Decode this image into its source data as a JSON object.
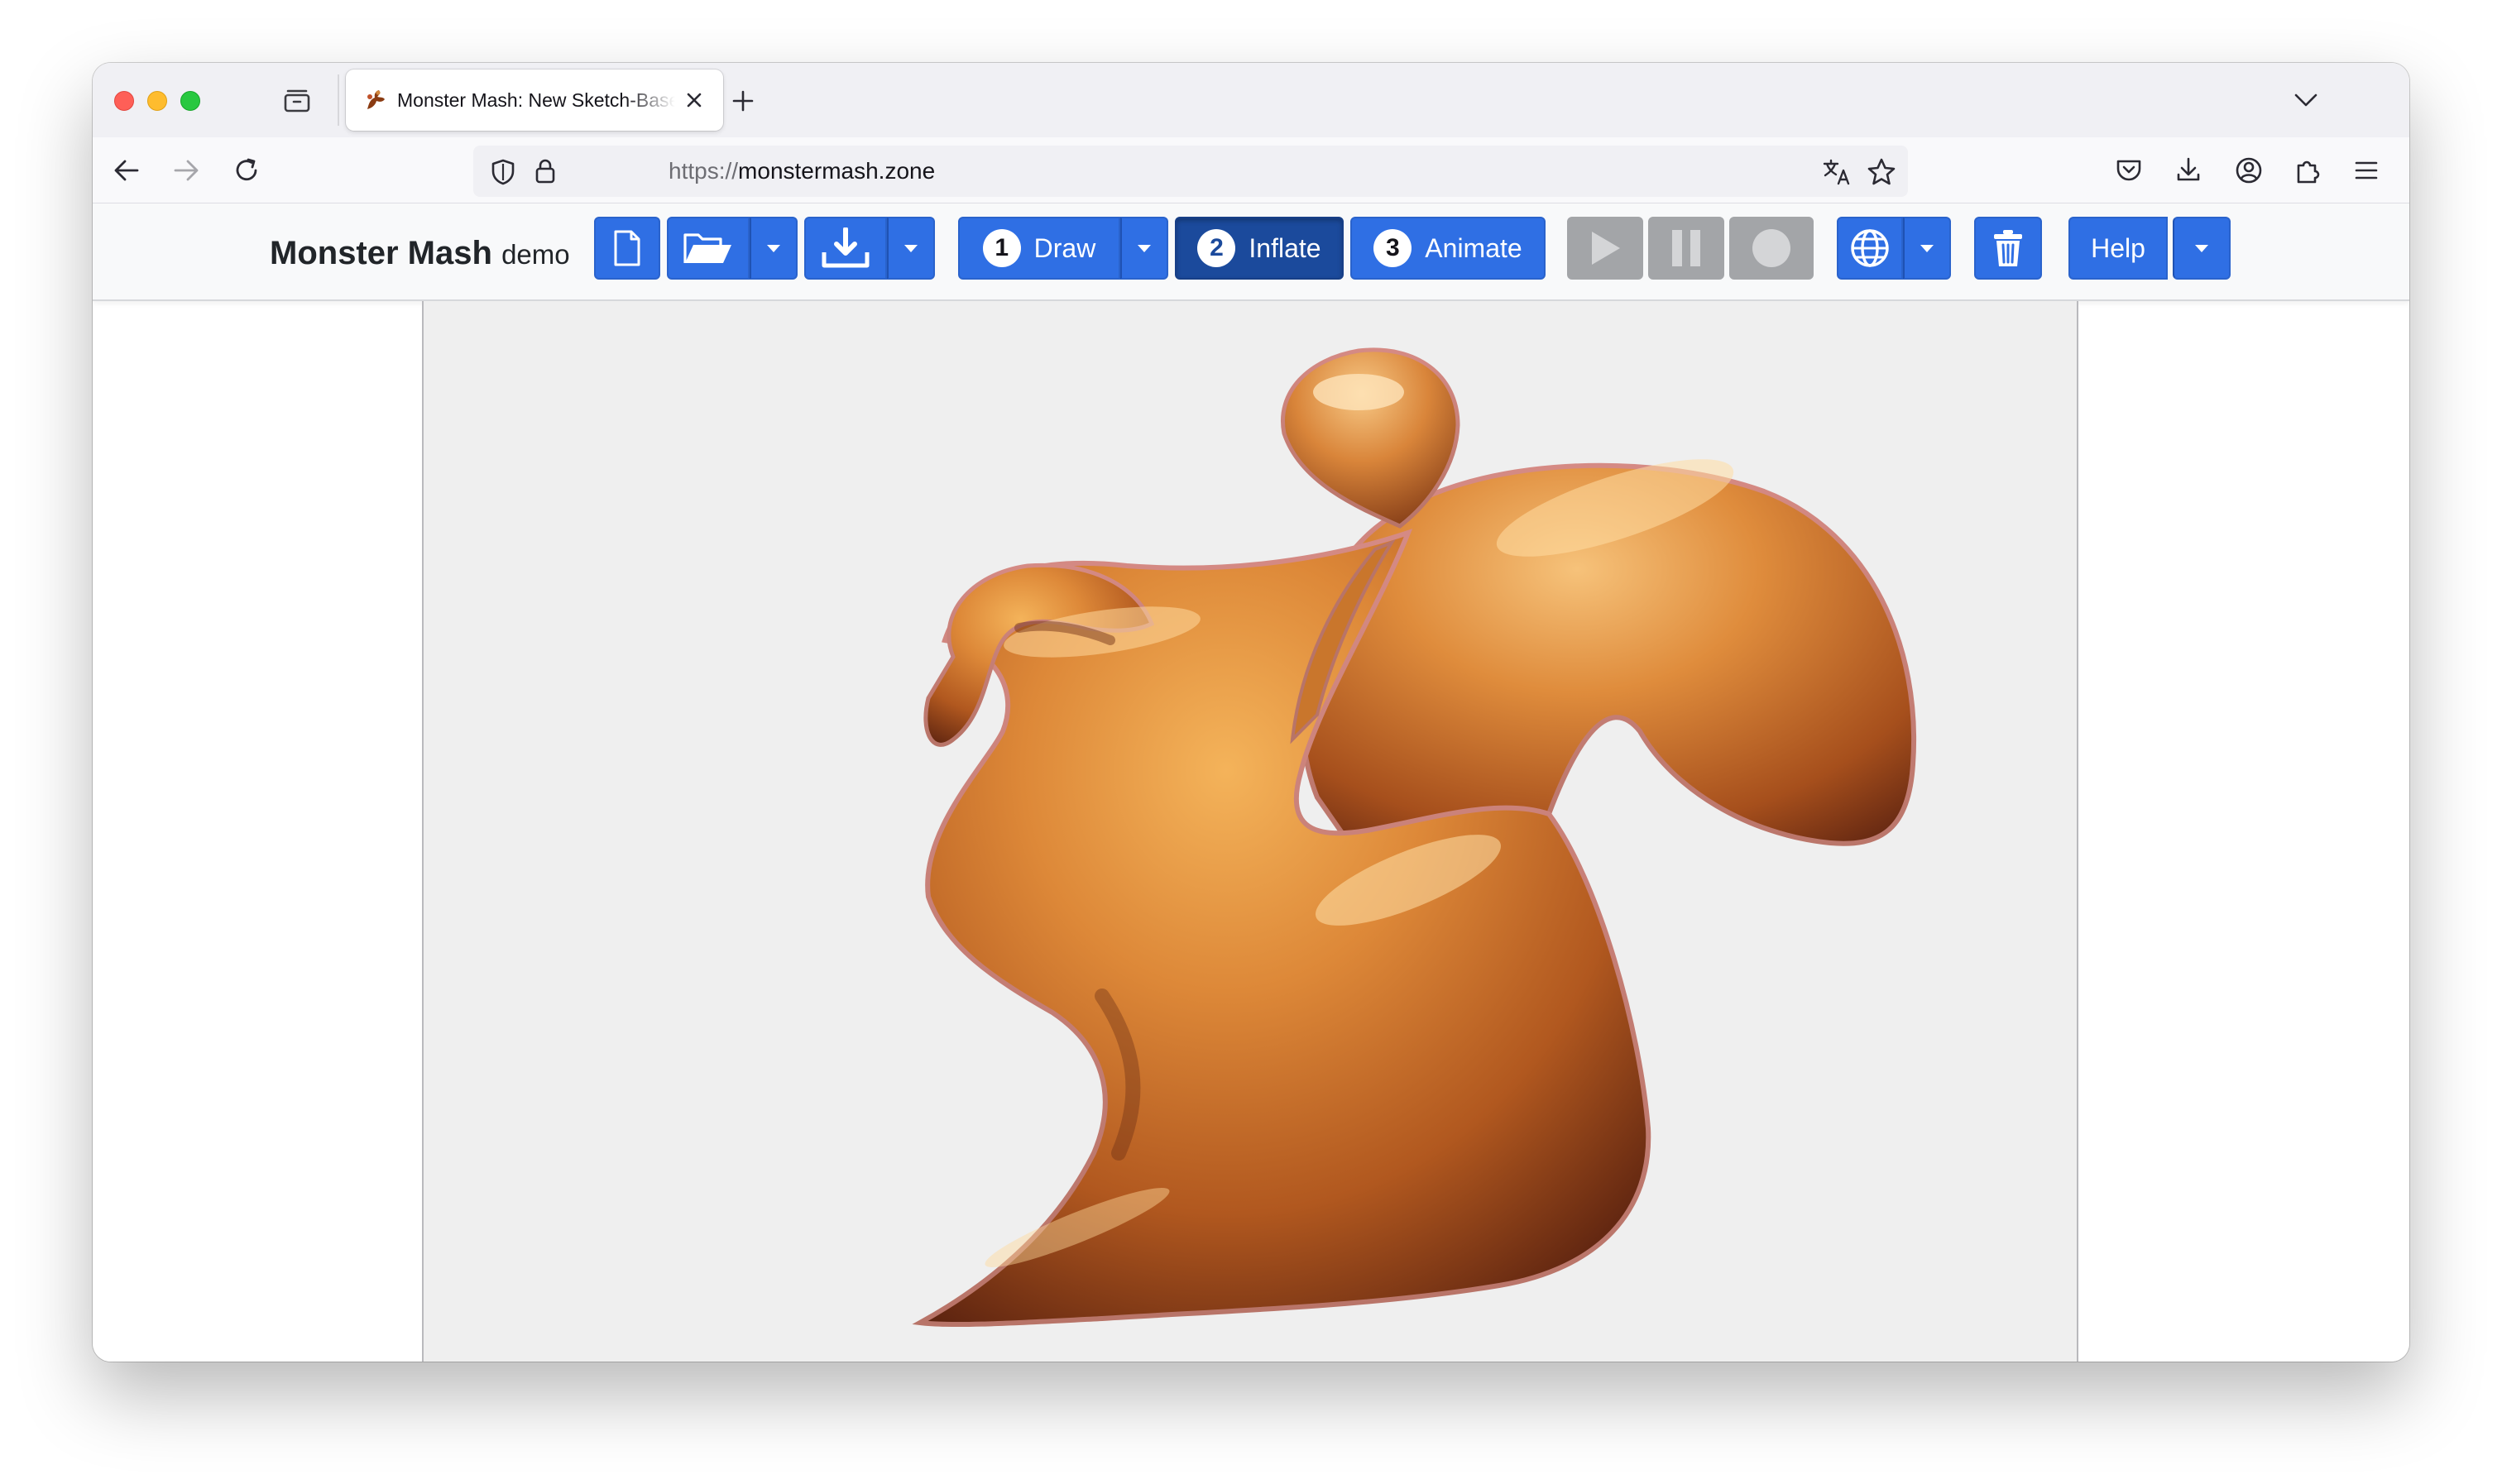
{
  "browser": {
    "tab": {
      "title": "Monster Mash: New Sketch-Based Modeling and Animation Tool"
    },
    "url": {
      "scheme": "https://",
      "host": "monstermash.zone"
    }
  },
  "app": {
    "brand": {
      "name": "Monster Mash",
      "suffix": "demo"
    },
    "steps": [
      {
        "number": "1",
        "label": "Draw"
      },
      {
        "number": "2",
        "label": "Inflate"
      },
      {
        "number": "3",
        "label": "Animate"
      }
    ],
    "active_step": "Inflate",
    "help_label": "Help"
  },
  "colors": {
    "button_primary": "#2f6fe4",
    "button_active": "#1b4a9c",
    "button_disabled": "#a3a5a8",
    "model_base": "#c9762c",
    "canvas_background": "#efefef"
  },
  "icons": [
    "new-file-icon",
    "open-folder-icon",
    "download-icon",
    "caret-down-icon",
    "play-icon",
    "pause-icon",
    "record-icon",
    "globe-icon",
    "trash-icon"
  ]
}
